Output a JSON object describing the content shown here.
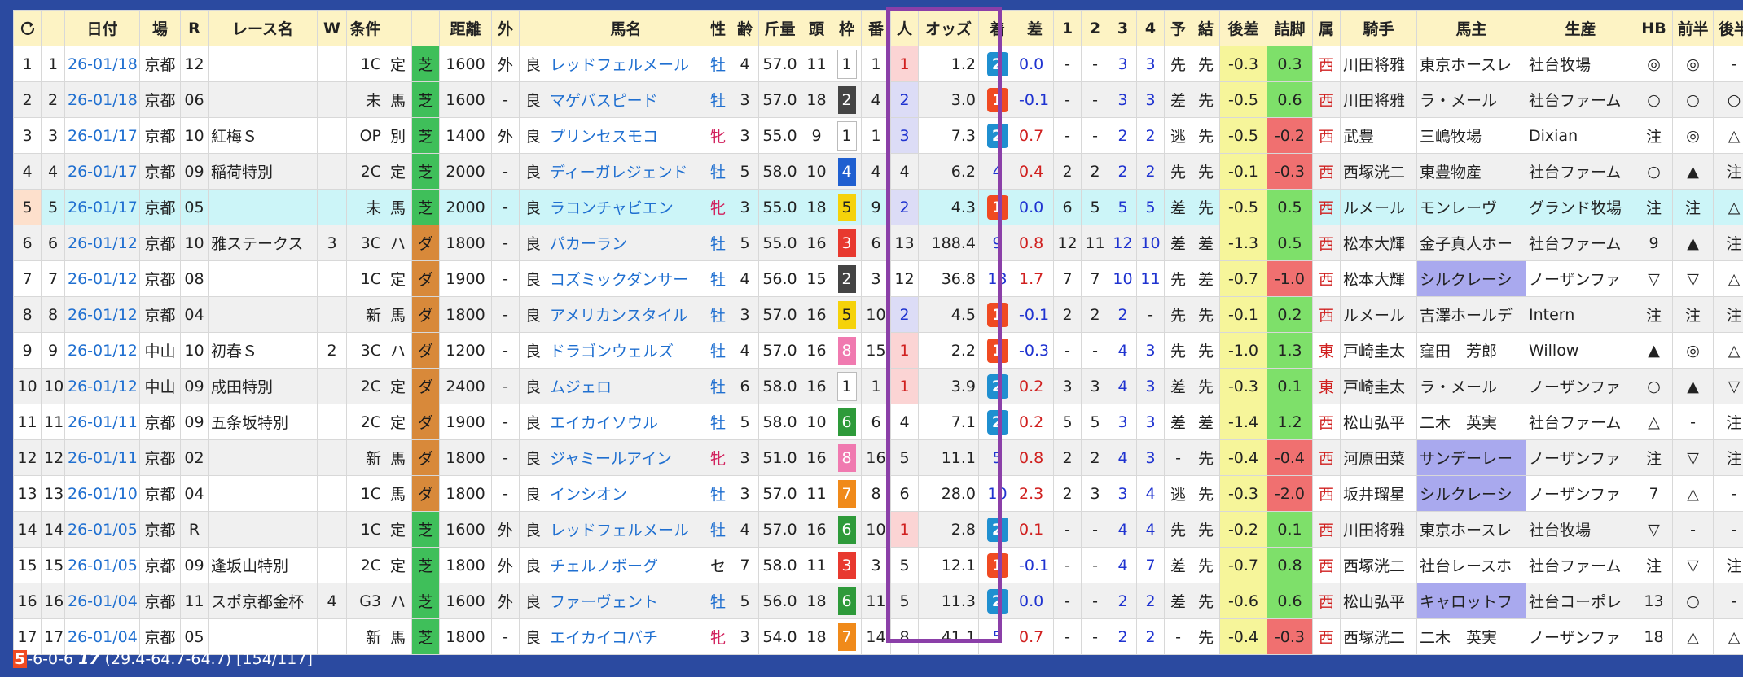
{
  "headers": [
    "",
    "",
    "日付",
    "場",
    "R",
    "レース名",
    "W",
    "条件",
    "",
    "",
    "距離",
    "外",
    "",
    "馬名",
    "性",
    "齢",
    "斤量",
    "頭",
    "枠",
    "番",
    "人",
    "オッズ",
    "着",
    "差",
    "1",
    "2",
    "3",
    "4",
    "予",
    "結",
    "後差",
    "詰脚",
    "属",
    "騎手",
    "馬主",
    "生産",
    "HB",
    "前半",
    "後半"
  ],
  "rows": [
    {
      "no": "1",
      "idx": "1",
      "date": "26-01/18",
      "venue": "京都",
      "race": "12",
      "name": "",
      "w": "",
      "cls": "1C",
      "wt": "定",
      "surf": "芝",
      "dist": "1600",
      "out": "外",
      "cond": "良",
      "horse": "レッドフェルメール",
      "sex": "牡",
      "age": "4",
      "kin": "57.0",
      "heads": "11",
      "waku": "1",
      "num": "1",
      "pop": "1",
      "odds": "1.2",
      "fin": "2",
      "diff": "0.0",
      "c1": "-",
      "c2": "-",
      "c3": "3",
      "c4": "3",
      "pred": "先",
      "res": "先",
      "kosa": "-0.3",
      "tume": "0.3",
      "zoku": "西",
      "jockey": "川田将雅",
      "owner": "東京ホースレ",
      "breeder": "社台牧場",
      "hb": "◎",
      "zen": "◎",
      "kou": "-"
    },
    {
      "no": "2",
      "idx": "2",
      "date": "26-01/18",
      "venue": "京都",
      "race": "06",
      "name": "",
      "w": "",
      "cls": "未",
      "wt": "馬",
      "surf": "芝",
      "dist": "1600",
      "out": "-",
      "cond": "良",
      "horse": "マゲバスピード",
      "sex": "牡",
      "age": "3",
      "kin": "57.0",
      "heads": "18",
      "waku": "2",
      "num": "4",
      "pop": "2",
      "odds": "3.0",
      "fin": "1",
      "diff": "-0.1",
      "c1": "-",
      "c2": "-",
      "c3": "3",
      "c4": "3",
      "pred": "差",
      "res": "先",
      "kosa": "-0.5",
      "tume": "0.6",
      "zoku": "西",
      "jockey": "川田将雅",
      "owner": "ラ・メール",
      "breeder": "社台ファーム",
      "hb": "○",
      "zen": "○",
      "kou": "○"
    },
    {
      "no": "3",
      "idx": "3",
      "date": "26-01/17",
      "venue": "京都",
      "race": "10",
      "name": "紅梅Ｓ",
      "w": "",
      "cls": "OP",
      "wt": "別",
      "surf": "芝",
      "dist": "1400",
      "out": "外",
      "cond": "良",
      "horse": "プリンセスモコ",
      "sex": "牝",
      "age": "3",
      "kin": "55.0",
      "heads": "9",
      "waku": "1",
      "num": "1",
      "pop": "3",
      "odds": "7.3",
      "fin": "2",
      "diff": "0.7",
      "c1": "-",
      "c2": "-",
      "c3": "2",
      "c4": "2",
      "pred": "逃",
      "res": "先",
      "kosa": "-0.5",
      "tume": "-0.2",
      "zoku": "西",
      "jockey": "武豊",
      "owner": "三嶋牧場",
      "breeder": "Dixian",
      "hb": "注",
      "zen": "◎",
      "kou": "△"
    },
    {
      "no": "4",
      "idx": "4",
      "date": "26-01/17",
      "venue": "京都",
      "race": "09",
      "name": "稲荷特別",
      "w": "",
      "cls": "2C",
      "wt": "定",
      "surf": "芝",
      "dist": "2000",
      "out": "-",
      "cond": "良",
      "horse": "ディーガレジェンド",
      "sex": "牡",
      "age": "5",
      "kin": "58.0",
      "heads": "10",
      "waku": "4",
      "num": "4",
      "pop": "4",
      "odds": "6.2",
      "fin": "4",
      "diff": "0.4",
      "c1": "2",
      "c2": "2",
      "c3": "2",
      "c4": "2",
      "pred": "先",
      "res": "先",
      "kosa": "-0.1",
      "tume": "-0.3",
      "zoku": "西",
      "jockey": "西塚洸二",
      "owner": "東豊物産",
      "breeder": "社台ファーム",
      "hb": "○",
      "zen": "▲",
      "kou": "注"
    },
    {
      "no": "5",
      "idx": "5",
      "date": "26-01/17",
      "venue": "京都",
      "race": "05",
      "name": "",
      "w": "",
      "cls": "未",
      "wt": "馬",
      "surf": "芝",
      "dist": "2000",
      "out": "-",
      "cond": "良",
      "horse": "ラコンチャビエン",
      "sex": "牝",
      "age": "3",
      "kin": "55.0",
      "heads": "18",
      "waku": "5",
      "num": "9",
      "pop": "2",
      "odds": "4.3",
      "fin": "1",
      "diff": "0.0",
      "c1": "6",
      "c2": "5",
      "c3": "5",
      "c4": "5",
      "pred": "差",
      "res": "先",
      "kosa": "-0.5",
      "tume": "0.5",
      "zoku": "西",
      "jockey": "ルメール",
      "owner": "モンレーヴ",
      "breeder": "グランド牧場",
      "hb": "注",
      "zen": "注",
      "kou": "△"
    },
    {
      "no": "6",
      "idx": "6",
      "date": "26-01/12",
      "venue": "京都",
      "race": "10",
      "name": "雅ステークス",
      "w": "3",
      "cls": "3C",
      "wt": "ハ",
      "surf": "ダ",
      "dist": "1800",
      "out": "-",
      "cond": "良",
      "horse": "パカーラン",
      "sex": "牡",
      "age": "5",
      "kin": "55.0",
      "heads": "16",
      "waku": "3",
      "num": "6",
      "pop": "13",
      "odds": "188.4",
      "fin": "9",
      "diff": "0.8",
      "c1": "12",
      "c2": "11",
      "c3": "12",
      "c4": "10",
      "pred": "差",
      "res": "差",
      "kosa": "-1.3",
      "tume": "0.5",
      "zoku": "西",
      "jockey": "松本大輝",
      "owner": "金子真人ホー",
      "breeder": "社台ファーム",
      "hb": "9",
      "zen": "▲",
      "kou": "注"
    },
    {
      "no": "7",
      "idx": "7",
      "date": "26-01/12",
      "venue": "京都",
      "race": "08",
      "name": "",
      "w": "",
      "cls": "1C",
      "wt": "定",
      "surf": "ダ",
      "dist": "1900",
      "out": "-",
      "cond": "良",
      "horse": "コズミックダンサー",
      "sex": "牡",
      "age": "4",
      "kin": "56.0",
      "heads": "15",
      "waku": "2",
      "num": "3",
      "pop": "12",
      "odds": "36.8",
      "fin": "13",
      "diff": "1.7",
      "c1": "7",
      "c2": "7",
      "c3": "10",
      "c4": "11",
      "pred": "先",
      "res": "差",
      "kosa": "-0.7",
      "tume": "-1.0",
      "zoku": "西",
      "jockey": "松本大輝",
      "owner": "シルクレーシ",
      "breeder": "ノーザンファ",
      "hb": "▽",
      "zen": "▽",
      "kou": "△"
    },
    {
      "no": "8",
      "idx": "8",
      "date": "26-01/12",
      "venue": "京都",
      "race": "04",
      "name": "",
      "w": "",
      "cls": "新",
      "wt": "馬",
      "surf": "ダ",
      "dist": "1800",
      "out": "-",
      "cond": "良",
      "horse": "アメリカンスタイル",
      "sex": "牡",
      "age": "3",
      "kin": "57.0",
      "heads": "16",
      "waku": "5",
      "num": "10",
      "pop": "2",
      "odds": "4.5",
      "fin": "1",
      "diff": "-0.1",
      "c1": "2",
      "c2": "2",
      "c3": "2",
      "c4": "-",
      "pred": "先",
      "res": "先",
      "kosa": "-0.1",
      "tume": "0.2",
      "zoku": "西",
      "jockey": "ルメール",
      "owner": "吉澤ホールデ",
      "breeder": "Intern",
      "hb": "注",
      "zen": "注",
      "kou": "注"
    },
    {
      "no": "9",
      "idx": "9",
      "date": "26-01/12",
      "venue": "中山",
      "race": "10",
      "name": "初春Ｓ",
      "w": "2",
      "cls": "3C",
      "wt": "ハ",
      "surf": "ダ",
      "dist": "1200",
      "out": "-",
      "cond": "良",
      "horse": "ドラゴンウェルズ",
      "sex": "牡",
      "age": "4",
      "kin": "57.0",
      "heads": "16",
      "waku": "8",
      "num": "15",
      "pop": "1",
      "odds": "2.2",
      "fin": "1",
      "diff": "-0.3",
      "c1": "-",
      "c2": "-",
      "c3": "4",
      "c4": "3",
      "pred": "先",
      "res": "先",
      "kosa": "-1.0",
      "tume": "1.3",
      "zoku": "東",
      "jockey": "戸崎圭太",
      "owner": "窪田　芳郎",
      "breeder": "Willow",
      "hb": "▲",
      "zen": "◎",
      "kou": "△"
    },
    {
      "no": "10",
      "idx": "10",
      "date": "26-01/12",
      "venue": "中山",
      "race": "09",
      "name": "成田特別",
      "w": "",
      "cls": "2C",
      "wt": "定",
      "surf": "ダ",
      "dist": "2400",
      "out": "-",
      "cond": "良",
      "horse": "ムジェロ",
      "sex": "牡",
      "age": "6",
      "kin": "58.0",
      "heads": "16",
      "waku": "1",
      "num": "1",
      "pop": "1",
      "odds": "3.9",
      "fin": "2",
      "diff": "0.2",
      "c1": "3",
      "c2": "3",
      "c3": "4",
      "c4": "3",
      "pred": "差",
      "res": "先",
      "kosa": "-0.3",
      "tume": "0.1",
      "zoku": "東",
      "jockey": "戸崎圭太",
      "owner": "ラ・メール",
      "breeder": "ノーザンファ",
      "hb": "○",
      "zen": "▲",
      "kou": "▽"
    },
    {
      "no": "11",
      "idx": "11",
      "date": "26-01/11",
      "venue": "京都",
      "race": "09",
      "name": "五条坂特別",
      "w": "",
      "cls": "2C",
      "wt": "定",
      "surf": "ダ",
      "dist": "1900",
      "out": "-",
      "cond": "良",
      "horse": "エイカイソウル",
      "sex": "牡",
      "age": "5",
      "kin": "58.0",
      "heads": "10",
      "waku": "6",
      "num": "6",
      "pop": "4",
      "odds": "7.1",
      "fin": "2",
      "diff": "0.2",
      "c1": "5",
      "c2": "5",
      "c3": "3",
      "c4": "3",
      "pred": "差",
      "res": "差",
      "kosa": "-1.4",
      "tume": "1.2",
      "zoku": "西",
      "jockey": "松山弘平",
      "owner": "二木　英実",
      "breeder": "社台ファーム",
      "hb": "△",
      "zen": "-",
      "kou": "注"
    },
    {
      "no": "12",
      "idx": "12",
      "date": "26-01/11",
      "venue": "京都",
      "race": "02",
      "name": "",
      "w": "",
      "cls": "新",
      "wt": "馬",
      "surf": "ダ",
      "dist": "1800",
      "out": "-",
      "cond": "良",
      "horse": "ジャミールアイン",
      "sex": "牝",
      "age": "3",
      "kin": "51.0",
      "heads": "16",
      "waku": "8",
      "num": "16",
      "pop": "5",
      "odds": "11.1",
      "fin": "5",
      "diff": "0.8",
      "c1": "2",
      "c2": "2",
      "c3": "4",
      "c4": "3",
      "pred": "-",
      "res": "先",
      "kosa": "-0.4",
      "tume": "-0.4",
      "zoku": "西",
      "jockey": "河原田菜",
      "owner": "サンデーレー",
      "breeder": "ノーザンファ",
      "hb": "注",
      "zen": "▽",
      "kou": "注"
    },
    {
      "no": "13",
      "idx": "13",
      "date": "26-01/10",
      "venue": "京都",
      "race": "04",
      "name": "",
      "w": "",
      "cls": "1C",
      "wt": "馬",
      "surf": "ダ",
      "dist": "1800",
      "out": "-",
      "cond": "良",
      "horse": "インシオン",
      "sex": "牡",
      "age": "3",
      "kin": "57.0",
      "heads": "11",
      "waku": "7",
      "num": "8",
      "pop": "6",
      "odds": "28.0",
      "fin": "10",
      "diff": "2.3",
      "c1": "2",
      "c2": "3",
      "c3": "3",
      "c4": "4",
      "pred": "逃",
      "res": "先",
      "kosa": "-0.3",
      "tume": "-2.0",
      "zoku": "西",
      "jockey": "坂井瑠星",
      "owner": "シルクレーシ",
      "breeder": "ノーザンファ",
      "hb": "7",
      "zen": "△",
      "kou": "-"
    },
    {
      "no": "14",
      "idx": "14",
      "date": "26-01/05",
      "venue": "京都",
      "race": "R",
      "name": "",
      "w": "",
      "cls": "1C",
      "wt": "定",
      "surf": "芝",
      "dist": "1600",
      "out": "外",
      "cond": "良",
      "horse": "レッドフェルメール",
      "sex": "牡",
      "age": "4",
      "kin": "57.0",
      "heads": "16",
      "waku": "6",
      "num": "10",
      "pop": "1",
      "odds": "2.8",
      "fin": "2",
      "diff": "0.1",
      "c1": "-",
      "c2": "-",
      "c3": "4",
      "c4": "4",
      "pred": "先",
      "res": "先",
      "kosa": "-0.2",
      "tume": "0.1",
      "zoku": "西",
      "jockey": "川田将雅",
      "owner": "東京ホースレ",
      "breeder": "社台牧場",
      "hb": "▽",
      "zen": "-",
      "kou": "-"
    },
    {
      "no": "15",
      "idx": "15",
      "date": "26-01/05",
      "venue": "京都",
      "race": "09",
      "name": "逢坂山特別",
      "w": "",
      "cls": "2C",
      "wt": "定",
      "surf": "芝",
      "dist": "1800",
      "out": "外",
      "cond": "良",
      "horse": "チェルノボーグ",
      "sex": "セ",
      "age": "7",
      "kin": "58.0",
      "heads": "11",
      "waku": "3",
      "num": "3",
      "pop": "5",
      "odds": "12.1",
      "fin": "1",
      "diff": "-0.1",
      "c1": "-",
      "c2": "-",
      "c3": "4",
      "c4": "7",
      "pred": "差",
      "res": "先",
      "kosa": "-0.7",
      "tume": "0.8",
      "zoku": "西",
      "jockey": "西塚洸二",
      "owner": "社台レースホ",
      "breeder": "社台ファーム",
      "hb": "注",
      "zen": "▽",
      "kou": "注"
    },
    {
      "no": "16",
      "idx": "16",
      "date": "26-01/04",
      "venue": "京都",
      "race": "11",
      "name": "スポ京都金杯",
      "w": "4",
      "cls": "G3",
      "wt": "ハ",
      "surf": "芝",
      "dist": "1600",
      "out": "外",
      "cond": "良",
      "horse": "ファーヴェント",
      "sex": "牡",
      "age": "5",
      "kin": "56.0",
      "heads": "18",
      "waku": "6",
      "num": "11",
      "pop": "5",
      "odds": "11.3",
      "fin": "2",
      "diff": "0.0",
      "c1": "-",
      "c2": "-",
      "c3": "2",
      "c4": "2",
      "pred": "差",
      "res": "先",
      "kosa": "-0.6",
      "tume": "0.6",
      "zoku": "西",
      "jockey": "松山弘平",
      "owner": "キャロットフ",
      "breeder": "社台コーポレ",
      "hb": "13",
      "zen": "○",
      "kou": "-"
    },
    {
      "no": "17",
      "idx": "17",
      "date": "26-01/04",
      "venue": "京都",
      "race": "05",
      "name": "",
      "w": "",
      "cls": "新",
      "wt": "馬",
      "surf": "芝",
      "dist": "1800",
      "out": "-",
      "cond": "良",
      "horse": "エイカイコバチ",
      "sex": "牝",
      "age": "3",
      "kin": "54.0",
      "heads": "18",
      "waku": "7",
      "num": "14",
      "pop": "8",
      "odds": "41.1",
      "fin": "5",
      "diff": "0.7",
      "c1": "-",
      "c2": "-",
      "c3": "2",
      "c4": "2",
      "pred": "-",
      "res": "先",
      "kosa": "-0.4",
      "tume": "-0.3",
      "zoku": "西",
      "jockey": "西塚洸二",
      "owner": "二木　英実",
      "breeder": "ノーザンファ",
      "hb": "18",
      "zen": "△",
      "kou": "△"
    }
  ],
  "status": {
    "wins": "5",
    "record": "-6-0-6",
    "count": "17",
    "rates": "(29.4-64.7-64.7)",
    "nums": "[154/117]"
  },
  "colors": {
    "background": "#2b4aa0",
    "header": "#fdf3c4",
    "turf": "#3fbf5a",
    "dirt": "#d8893a",
    "highlight_box": "#8b3fa8",
    "win": "#f04a22",
    "second": "#1f8fd0"
  },
  "icons": {
    "refresh": "refresh-icon"
  }
}
